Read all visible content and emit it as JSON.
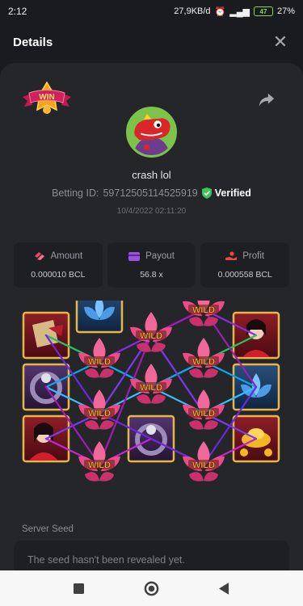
{
  "status_bar": {
    "time": "2:12",
    "net_speed": "27,9KB/d",
    "battery": "27%",
    "battery_level": "47"
  },
  "header": {
    "title": "Details",
    "close_glyph": "✕"
  },
  "win_badge": {
    "text": "WIN"
  },
  "player": {
    "name": "crash lol",
    "betting_id_label": "Betting ID:",
    "betting_id": "59712505114525919",
    "verified_label": "Verified",
    "date": "10/4/2022 02:11:20"
  },
  "stats": [
    {
      "label": "Amount",
      "value": "0.000010 BCL",
      "icon": "coins-icon",
      "color": "#e8496a"
    },
    {
      "label": "Payout",
      "value": "56.8 x",
      "icon": "wallet-icon",
      "color": "#9b52e0"
    },
    {
      "label": "Profit",
      "value": "0.000558 BCL",
      "icon": "profit-hand-icon",
      "color": "#e64a3f"
    }
  ],
  "reels": {
    "wild_text": "WILD",
    "line_colors": [
      "#8a2be2",
      "#c026d3",
      "#22c55e",
      "#0ea5e9",
      "#a21caf",
      "#7c3aed",
      "#38bdf8"
    ]
  },
  "server_seed": {
    "label": "Server Seed",
    "value": "The seed hasn't been revealed yet."
  },
  "navbar": {
    "items": [
      "recent-apps-button",
      "home-button",
      "back-button"
    ]
  }
}
